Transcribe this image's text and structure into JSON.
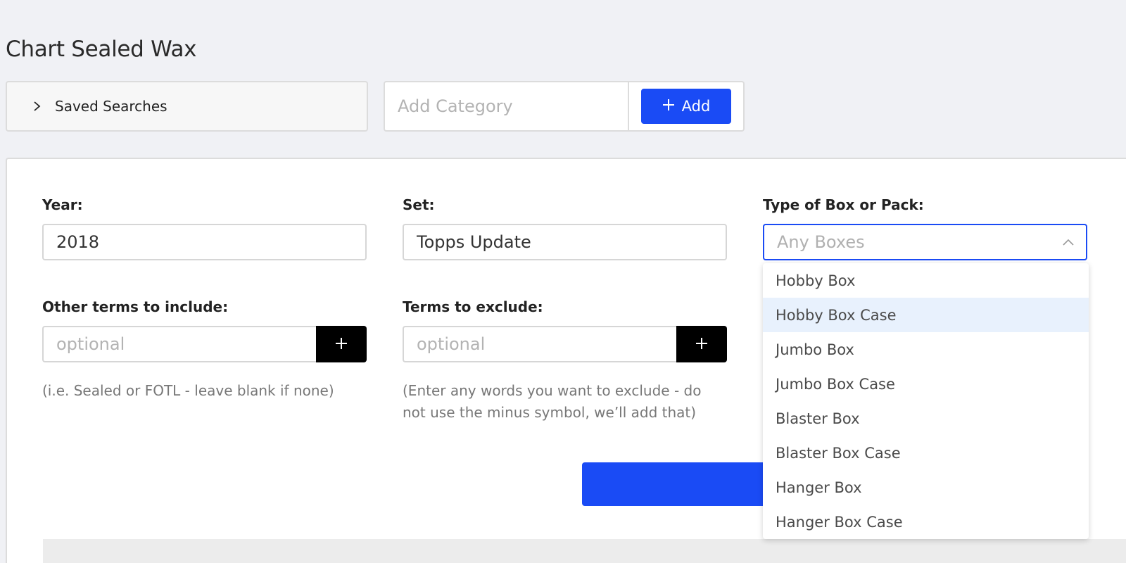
{
  "page": {
    "title": "Chart Sealed Wax"
  },
  "saved_searches": {
    "label": "Saved Searches"
  },
  "add_category": {
    "placeholder": "Add Category",
    "button_label": "Add"
  },
  "form": {
    "year": {
      "label": "Year:",
      "value": "2018"
    },
    "set": {
      "label": "Set:",
      "value": "Topps Update"
    },
    "type": {
      "label": "Type of Box or Pack:",
      "placeholder": "Any Boxes",
      "options": [
        "Hobby Box",
        "Hobby Box Case",
        "Jumbo Box",
        "Jumbo Box Case",
        "Blaster Box",
        "Blaster Box Case",
        "Hanger Box",
        "Hanger Box Case"
      ],
      "highlighted_index": 1
    },
    "include": {
      "label": "Other terms to include:",
      "placeholder": "optional",
      "hint": "(i.e. Sealed or FOTL - leave blank if none)"
    },
    "exclude": {
      "label": "Terms to exclude:",
      "placeholder": "optional",
      "hint_line1": "(Enter any words you want to exclude - do",
      "hint_line2": "not use the minus symbol, we’ll add that)"
    }
  },
  "colors": {
    "accent": "#1a4bf5",
    "background": "#f0f1f5",
    "highlight": "#e8f1fd"
  }
}
